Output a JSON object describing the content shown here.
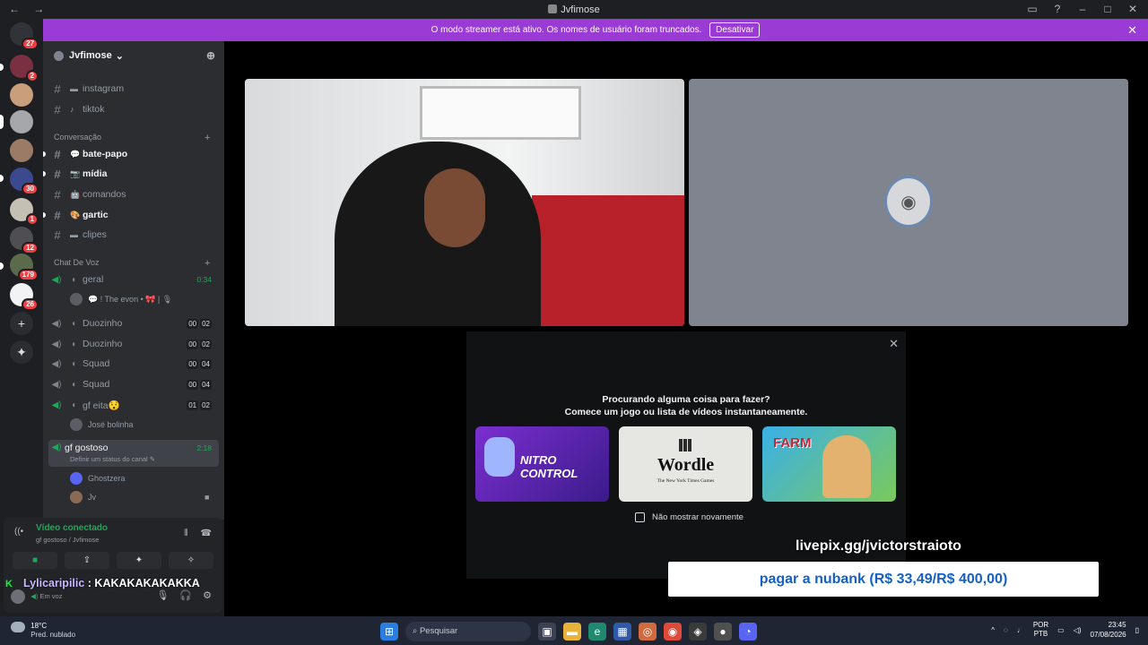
{
  "window": {
    "title": "Jvfimose",
    "nav": "← →",
    "controls": [
      "▭",
      "?",
      "–",
      "□",
      "✕"
    ]
  },
  "banner": {
    "text": "O modo streamer está ativo. Os nomes de usuário foram truncados.",
    "button": "Desativar",
    "close": "✕"
  },
  "servers": [
    {
      "badge": "27"
    },
    {
      "badge": "2"
    },
    {
      "badge": ""
    },
    {
      "badge": ""
    },
    {
      "badge": ""
    },
    {
      "badge": "30"
    },
    {
      "badge": "1"
    },
    {
      "badge": "12"
    },
    {
      "badge": "179"
    },
    {
      "badge": "26"
    }
  ],
  "server_actions": {
    "add": "+",
    "explore": "✦"
  },
  "guild": {
    "name": "Jvfimose",
    "chevron": "⌄"
  },
  "channels_top": [
    {
      "name": "instagram",
      "emoji": "▬"
    },
    {
      "name": "tiktok",
      "emoji": "♪"
    }
  ],
  "category_conversa": {
    "label": "Conversação",
    "plus": "+"
  },
  "channels_conversa": [
    {
      "name": "bate-papo",
      "emoji": "💬",
      "unread": true
    },
    {
      "name": "mídia",
      "emoji": "📷",
      "unread": true
    },
    {
      "name": "comandos",
      "emoji": "🤖",
      "unread": false
    },
    {
      "name": "gartic",
      "emoji": "🎨",
      "unread": true
    },
    {
      "name": "clipes",
      "emoji": "▬",
      "unread": false
    }
  ],
  "category_voz": {
    "label": "Chat De Voz",
    "plus": "+"
  },
  "voice_channels": [
    {
      "name": "geral",
      "time": "0:34"
    },
    {
      "name": "Duozinho",
      "lim": [
        "00",
        "02"
      ]
    },
    {
      "name": "Duozinho",
      "lim": [
        "00",
        "02"
      ]
    },
    {
      "name": "Squad",
      "lim": [
        "00",
        "04"
      ]
    },
    {
      "name": "Squad",
      "lim": [
        "00",
        "04"
      ]
    },
    {
      "name": "gf eita😯",
      "lim": [
        "01",
        "02"
      ]
    }
  ],
  "geral_member": "💬 ! The evon • 🎀 | 🎙",
  "eita_member": "José bolinha",
  "selected_channel": {
    "name": "gf gostoso",
    "time": "2:18",
    "status": "Definir um status do canal ✎"
  },
  "selected_members": [
    {
      "name": "Ghostzera"
    },
    {
      "name": "Jv",
      "cam": "■"
    }
  ],
  "voice_panel": {
    "status": "Vídeo conectado",
    "location": "gf gostoso / Jvfimose",
    "buttons": [
      "■",
      "⇪",
      "✦",
      "✧"
    ]
  },
  "overlay_chat": {
    "k": "K",
    "name": "Lylicaripilic",
    "message": " : KAKAKAKAKAKKA"
  },
  "user": {
    "status": "Em voz",
    "controls": [
      "🎙",
      "🎧",
      "⚙"
    ]
  },
  "avatar_tile_icon": "◉",
  "activity": {
    "question1": "Procurando alguma coisa para fazer?",
    "question2": "Comece um jogo ou lista de vídeos instantaneamente.",
    "cards": [
      {
        "label": "NITRO CONTROL"
      },
      {
        "label": "Wordle",
        "sub": "The New York Times Games"
      },
      {
        "label": "FARM"
      }
    ],
    "checkbox": "Não mostrar novamente",
    "close": "✕"
  },
  "stream_overlay": {
    "livepix": "livepix.gg/jvictorstraioto",
    "nubank": "pagar a nubank (R$ 33,49/R$ 400,00)"
  },
  "taskbar": {
    "temp": "18°C",
    "weather": "Pred. nublado",
    "search": "Pesquisar",
    "lang1": "POR",
    "lang2": "PTB",
    "time": "23:45",
    "date": "07/08/2026"
  }
}
